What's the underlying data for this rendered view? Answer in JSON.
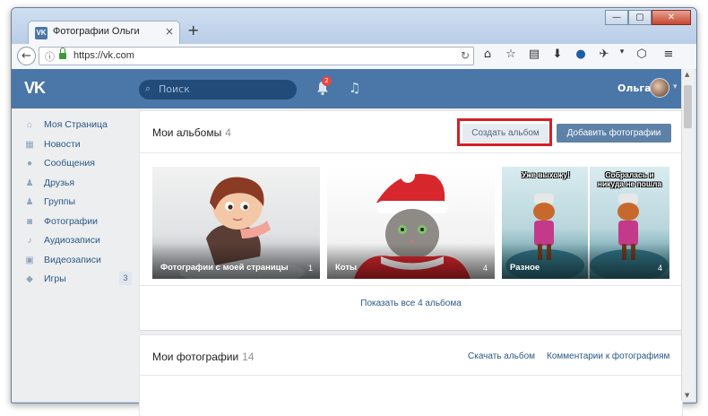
{
  "browser": {
    "tab_title": "Фотографии Ольги",
    "tab_close": "×",
    "new_tab": "+",
    "url": "https://vk.com",
    "back": "←",
    "info": "ⓘ",
    "reload": "↻",
    "win_min": "—",
    "win_max": "▢",
    "win_close": "✕",
    "favicon_text": "VK"
  },
  "vk": {
    "logo": "VK",
    "search_placeholder": "Поиск",
    "notifications_count": "2",
    "user_name": "Ольга",
    "accent": "#4a76a8"
  },
  "sidebar": {
    "items": [
      {
        "label": "Моя Страница",
        "icon": "home-icon"
      },
      {
        "label": "Новости",
        "icon": "news-icon"
      },
      {
        "label": "Сообщения",
        "icon": "messages-icon"
      },
      {
        "label": "Друзья",
        "icon": "friends-icon"
      },
      {
        "label": "Группы",
        "icon": "groups-icon"
      },
      {
        "label": "Фотографии",
        "icon": "camera-icon"
      },
      {
        "label": "Аудиозаписи",
        "icon": "audio-icon"
      },
      {
        "label": "Видеозаписи",
        "icon": "video-icon"
      },
      {
        "label": "Игры",
        "icon": "gamepad-icon",
        "count": "3"
      }
    ]
  },
  "albums_section": {
    "title": "Мои альбомы",
    "count": "4",
    "create_button": "Создать альбом",
    "add_photos_button": "Добавить фотографии",
    "albums": [
      {
        "label": "Фотографии с моей страницы",
        "count": "1"
      },
      {
        "label": "Коты",
        "count": "4"
      },
      {
        "label": "Разное",
        "count": "4",
        "captions": [
          "Уже выхожу!",
          "Собралась и никуда не пошла"
        ]
      }
    ],
    "show_all": "Показать все 4 альбома"
  },
  "photos_section": {
    "title": "Мои фотографии",
    "count": "14",
    "download_link": "Скачать альбом",
    "comments_link": "Комментарии к фотографиям"
  }
}
